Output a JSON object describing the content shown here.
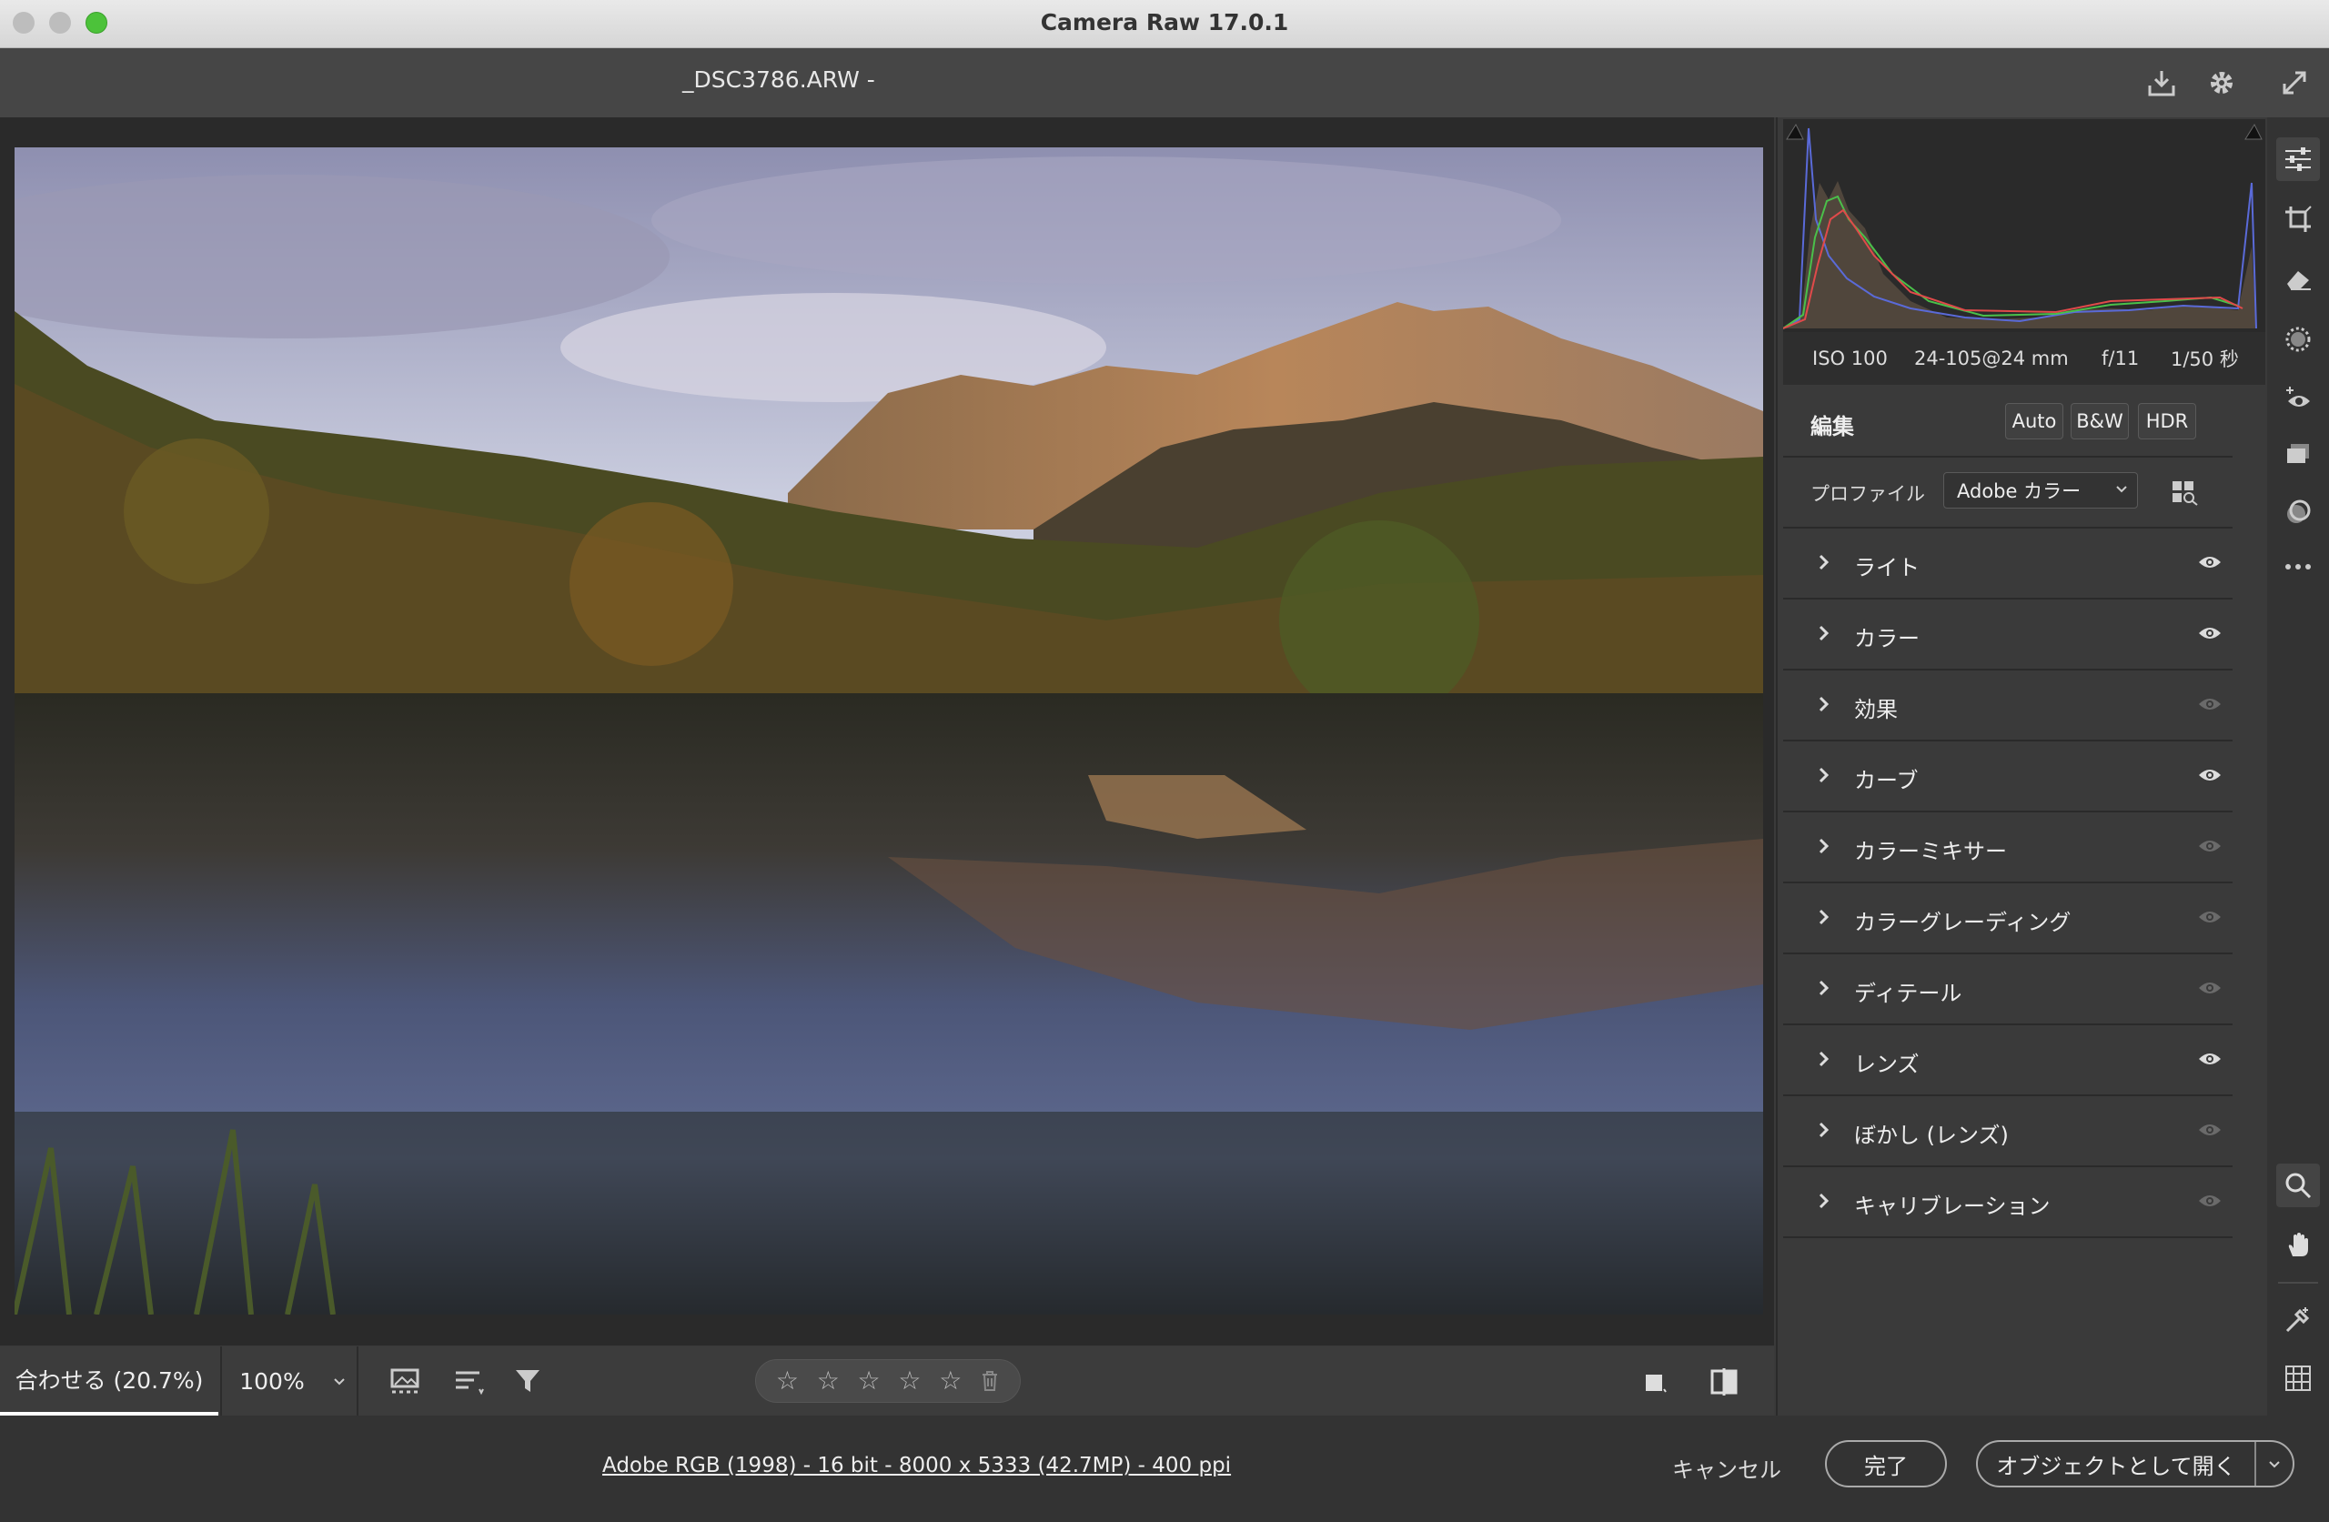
{
  "window": {
    "title": "Camera Raw 17.0.1"
  },
  "header": {
    "filename": "_DSC3786.ARW  -",
    "icons": [
      "save-image-icon",
      "settings-gear-icon",
      "fullscreen-icon"
    ]
  },
  "image": {
    "description_icon": "landscape-photo"
  },
  "bottombar": {
    "zoom_fit": "合わせる (20.7%)",
    "zoom_100": "100%",
    "icons": [
      "filmstrip-icon",
      "sort-icon",
      "filter-icon",
      "trash-icon",
      "single-view-icon",
      "before-after-icon"
    ],
    "stars": [
      "☆",
      "☆",
      "☆",
      "☆",
      "☆"
    ]
  },
  "footer": {
    "image_info": "Adobe RGB (1998) - 16 bit - 8000 x 5333 (42.7MP) - 400 ppi",
    "cancel": "キャンセル",
    "done": "完了",
    "open_object": "オブジェクトとして開く"
  },
  "exif": {
    "iso": "ISO 100",
    "lens": "24-105@24 mm",
    "aperture": "f/11",
    "shutter": "1/50 秒"
  },
  "edit": {
    "title": "編集",
    "auto": "Auto",
    "bw": "B&W",
    "hdr": "HDR",
    "profile_label": "プロファイル",
    "profile_value": "Adobe カラー"
  },
  "sections": [
    {
      "label": "ライト",
      "visible": true
    },
    {
      "label": "カラー",
      "visible": true
    },
    {
      "label": "効果",
      "visible": false
    },
    {
      "label": "カーブ",
      "visible": true
    },
    {
      "label": "カラーミキサー",
      "visible": false
    },
    {
      "label": "カラーグレーディング",
      "visible": false
    },
    {
      "label": "ディテール",
      "visible": false
    },
    {
      "label": "レンズ",
      "visible": true
    },
    {
      "label": "ぼかし (レンズ)",
      "visible": false
    },
    {
      "label": "キャリブレーション",
      "visible": false
    }
  ],
  "tools": [
    "edit-sliders-icon",
    "crop-icon",
    "eraser-icon",
    "masking-icon",
    "red-eye-icon",
    "presets-icon",
    "snapshots-icon",
    "more-icon",
    "zoom-icon",
    "hand-icon",
    "sampler-icon",
    "grid-icon"
  ]
}
